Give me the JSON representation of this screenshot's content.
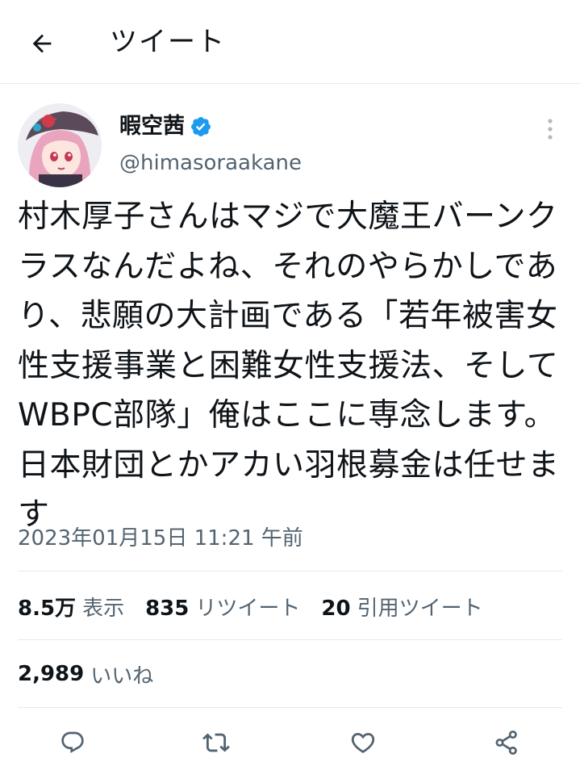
{
  "header": {
    "title": "ツイート"
  },
  "author": {
    "display_name": "暇空茜",
    "handle": "@himasoraakane"
  },
  "tweet": {
    "text": "村木厚子さんはマジで大魔王バーンクラスなんだよね、それのやらかしであり、悲願の大計画である「若年被害女性支援事業と困難女性支援法、そしてWBPC部隊」俺はここに専念します。日本財団とかアカい羽根募金は任せます",
    "timestamp": "2023年01月15日 11:21 午前"
  },
  "stats": {
    "views_count": "8.5万",
    "views_label": "表示",
    "retweets_count": "835",
    "retweets_label": "リツイート",
    "quotes_count": "20",
    "quotes_label": "引用ツイート",
    "likes_count": "2,989",
    "likes_label": "いいね"
  },
  "icons": {
    "back": "arrow-left-icon",
    "verified": "verified-badge-icon",
    "more": "more-vertical-icon",
    "reply": "reply-icon",
    "retweet": "retweet-icon",
    "like": "heart-icon",
    "share": "share-icon"
  },
  "colors": {
    "verified": "#1d9bf0",
    "secondary_text": "#536471",
    "divider": "#e6e9eb",
    "text": "#0f1419"
  }
}
